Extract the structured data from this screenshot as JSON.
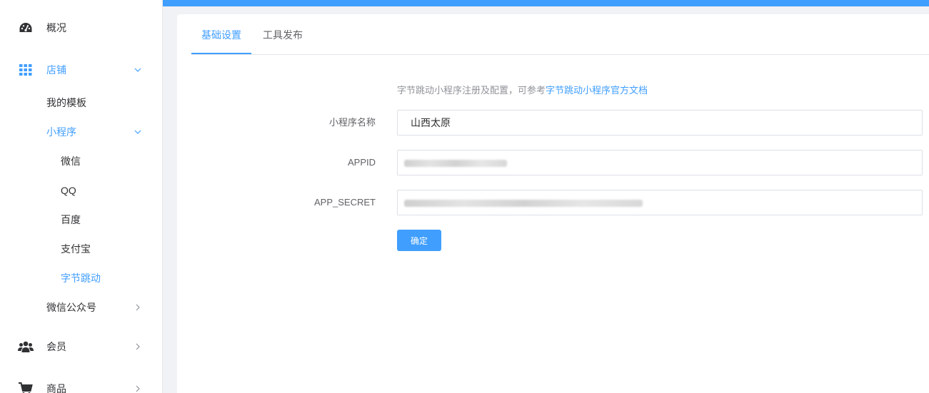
{
  "sidebar": {
    "overview": "概况",
    "store": "店铺",
    "my_templates": "我的模板",
    "mini_program": "小程序",
    "wechat": "微信",
    "qq": "QQ",
    "baidu": "百度",
    "alipay": "支付宝",
    "bytedance": "字节跳动",
    "wechat_official": "微信公众号",
    "members": "会员",
    "products": "商品"
  },
  "tabs": {
    "basic": "基础设置",
    "publish": "工具发布"
  },
  "form": {
    "hint_prefix": "字节跳动小程序注册及配置，可参考",
    "hint_link": "字节跳动小程序官方文档",
    "name_label": "小程序名称",
    "name_value": "山西太原",
    "appid_label": "APPID",
    "secret_label": "APP_SECRET",
    "submit": "确定"
  },
  "colors": {
    "accent": "#409eff",
    "text": "#303133",
    "muted": "#909399"
  },
  "icons": {
    "overview": "dashboard-icon",
    "store": "grid-icon",
    "members": "users-icon",
    "products": "cart-icon"
  }
}
